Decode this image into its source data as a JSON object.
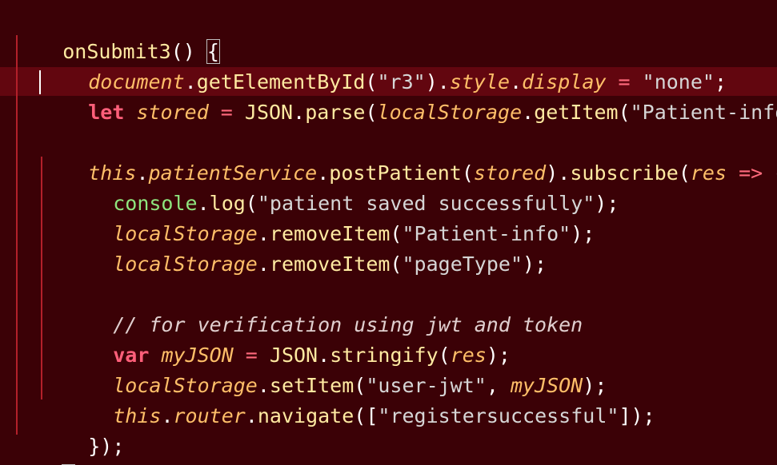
{
  "editor": {
    "lines": [
      {
        "parts": [
          "onSubmit3",
          "()",
          " ",
          "{"
        ]
      },
      {
        "parts": [
          "document",
          ".",
          "getElementById",
          "(",
          "\"r3\"",
          ").",
          "style",
          ".",
          "display",
          " = ",
          "\"none\"",
          ";"
        ]
      },
      {
        "parts": [
          "let",
          " ",
          "stored",
          " = ",
          "JSON",
          ".",
          "parse",
          "(",
          "localStorage",
          ".",
          "getItem",
          "(",
          "\"Patient-info\"",
          ")"
        ]
      },
      {
        "parts": []
      },
      {
        "parts": [
          "this",
          ".",
          "patientService",
          ".",
          "postPatient",
          "(",
          "stored",
          ").",
          "subscribe",
          "(",
          "res",
          " => ",
          "{"
        ]
      },
      {
        "parts": [
          "console",
          ".",
          "log",
          "(",
          "\"patient saved successfully\"",
          ");"
        ]
      },
      {
        "parts": [
          "localStorage",
          ".",
          "removeItem",
          "(",
          "\"Patient-info\"",
          ");"
        ]
      },
      {
        "parts": [
          "localStorage",
          ".",
          "removeItem",
          "(",
          "\"pageType\"",
          ");"
        ]
      },
      {
        "parts": []
      },
      {
        "parts": [
          "// for verification using jwt and token"
        ]
      },
      {
        "parts": [
          "var",
          " ",
          "myJSON",
          " = ",
          "JSON",
          ".",
          "stringify",
          "(",
          "res",
          ");"
        ]
      },
      {
        "parts": [
          "localStorage",
          ".",
          "setItem",
          "(",
          "\"user-jwt\"",
          ", ",
          "myJSON",
          ");"
        ]
      },
      {
        "parts": [
          "this",
          ".",
          "router",
          ".",
          "navigate",
          "([",
          "\"registersuccessful\"",
          "]);"
        ]
      },
      {
        "parts": [
          "});"
        ]
      },
      {
        "parts": [
          "}"
        ]
      }
    ]
  },
  "colors": {
    "background": "#3b0106",
    "current_line": "#62060f",
    "keyword": "#ff5f7a",
    "identifier": "#ffbf69",
    "string": "#d6d6d6",
    "function": "#ffeaa1",
    "console": "#8ee57e",
    "indent_guide": "#b3202a"
  }
}
